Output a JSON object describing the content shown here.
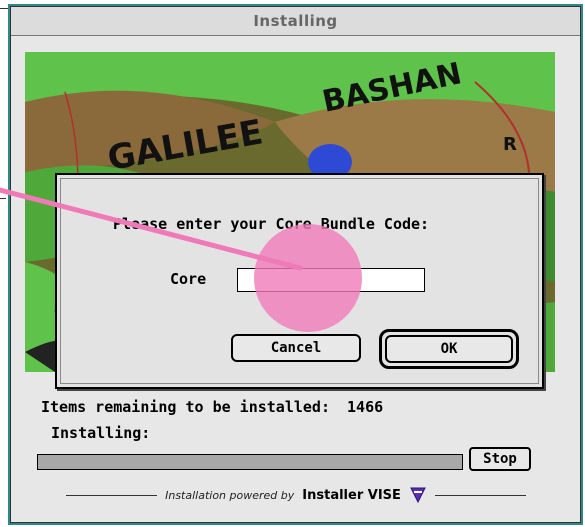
{
  "window": {
    "title": "Installing"
  },
  "map": {
    "labels": [
      "BASHAN",
      "GALILEE",
      "R"
    ]
  },
  "dialog": {
    "prompt": "Please enter your Core Bundle Code:",
    "field_label": "Core",
    "field_value": "",
    "cancel_label": "Cancel",
    "ok_label": "OK"
  },
  "status": {
    "remaining_label": "Items remaining to be installed:",
    "remaining_count": "1466",
    "installing_label": "Installing:",
    "progress": 0,
    "stop_label": "Stop"
  },
  "footer": {
    "powered_by": "Installation powered by",
    "product": "Installer VISE",
    "icon": "vise-logo-icon"
  },
  "colors": {
    "window_accent": "#2d8a86",
    "pointer": "#f07ab8"
  }
}
